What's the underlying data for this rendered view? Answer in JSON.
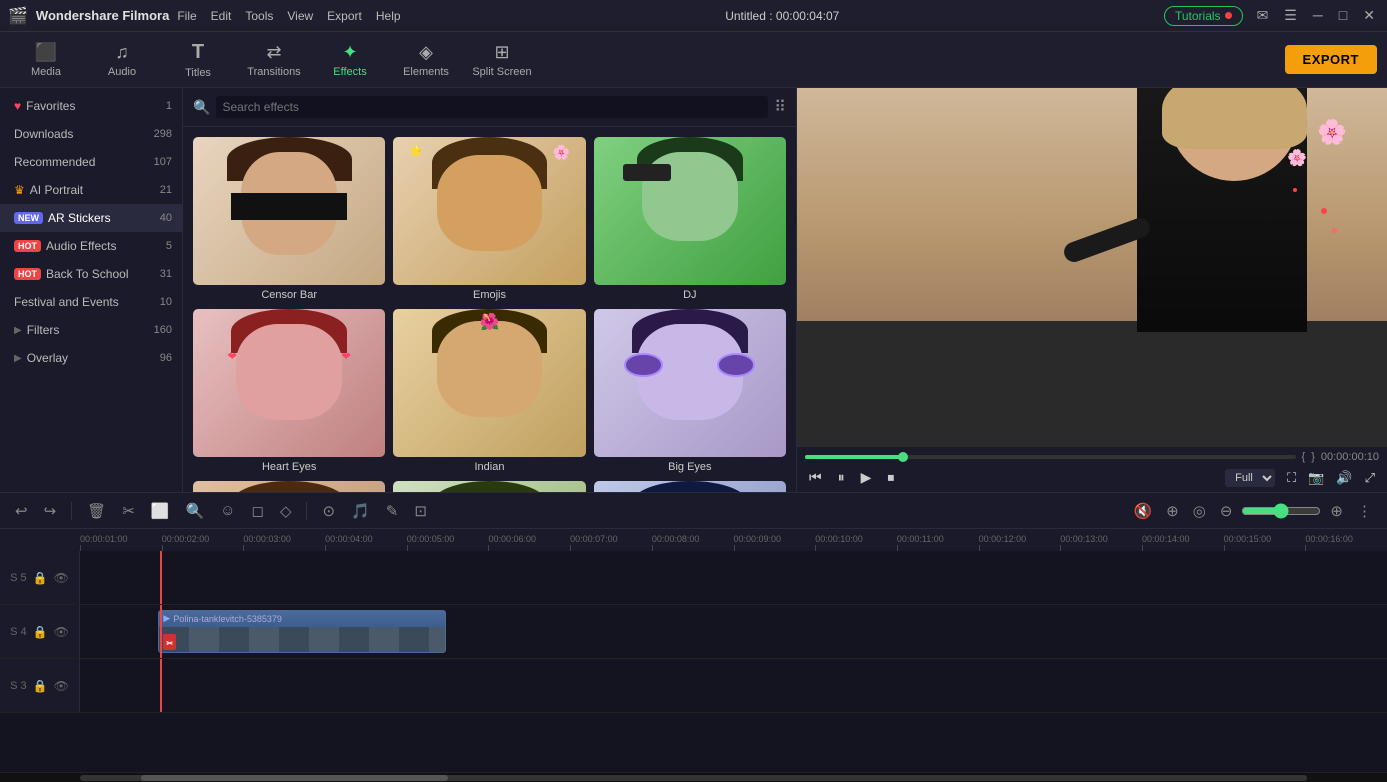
{
  "app": {
    "name": "Wondershare Filmora",
    "title": "Untitled : 00:00:04:07",
    "logo": "🎬"
  },
  "menu": {
    "items": [
      "File",
      "Edit",
      "Tools",
      "View",
      "Export",
      "Help"
    ]
  },
  "header": {
    "tutorials_label": "Tutorials",
    "export_label": "EXPORT"
  },
  "toolbar": {
    "items": [
      {
        "id": "media",
        "label": "Media",
        "icon": "⬜"
      },
      {
        "id": "audio",
        "label": "Audio",
        "icon": "♪"
      },
      {
        "id": "titles",
        "label": "Titles",
        "icon": "T"
      },
      {
        "id": "transitions",
        "label": "Transitions",
        "icon": "⇄"
      },
      {
        "id": "effects",
        "label": "Effects",
        "icon": "✦",
        "active": true
      },
      {
        "id": "elements",
        "label": "Elements",
        "icon": "◈"
      },
      {
        "id": "splitscreen",
        "label": "Split Screen",
        "icon": "⊞"
      }
    ]
  },
  "sidebar": {
    "items": [
      {
        "id": "favorites",
        "label": "Favorites",
        "count": 1,
        "icon": "heart"
      },
      {
        "id": "downloads",
        "label": "Downloads",
        "count": 298,
        "icon": ""
      },
      {
        "id": "recommended",
        "label": "Recommended",
        "count": 107,
        "icon": ""
      },
      {
        "id": "ai-portrait",
        "label": "AI Portrait",
        "count": 21,
        "icon": "crown"
      },
      {
        "id": "ar-stickers",
        "label": "AR Stickers",
        "count": 40,
        "icon": "new",
        "active": true
      },
      {
        "id": "audio-effects",
        "label": "Audio Effects",
        "count": 5,
        "icon": "hot"
      },
      {
        "id": "back-to-school",
        "label": "Back To School",
        "count": 31,
        "icon": "hot"
      },
      {
        "id": "festival-events",
        "label": "Festival and Events",
        "count": 10,
        "icon": ""
      },
      {
        "id": "filters",
        "label": "Filters",
        "count": 160,
        "icon": "arrow"
      },
      {
        "id": "overlay",
        "label": "Overlay",
        "count": 96,
        "icon": "arrow"
      }
    ]
  },
  "effects": {
    "search_placeholder": "Search effects",
    "items": [
      {
        "id": "censor-bar",
        "label": "Censor Bar",
        "type": "censor"
      },
      {
        "id": "emojis",
        "label": "Emojis",
        "type": "emoji"
      },
      {
        "id": "dj",
        "label": "DJ",
        "type": "dj"
      },
      {
        "id": "heart-eyes",
        "label": "Heart Eyes",
        "type": "heart"
      },
      {
        "id": "indian",
        "label": "Indian",
        "type": "indian"
      },
      {
        "id": "big-eyes",
        "label": "Big Eyes",
        "type": "bigeyes"
      },
      {
        "id": "effect7",
        "label": "",
        "type": "censor"
      },
      {
        "id": "effect8",
        "label": "",
        "type": "emoji"
      },
      {
        "id": "effect9",
        "label": "",
        "type": "heart"
      }
    ]
  },
  "preview": {
    "timecode": "00:00:00:10",
    "quality": "Full",
    "playhead_pct": 20
  },
  "timeline": {
    "ruler_marks": [
      "00:00:01:00",
      "00:00:02:00",
      "00:00:03:00",
      "00:00:04:00",
      "00:00:05:00",
      "00:00:06:00",
      "00:00:07:00",
      "00:00:08:00",
      "00:00:09:00",
      "00:00:10:00",
      "00:00:11:00",
      "00:00:12:00",
      "00:00:13:00",
      "00:00:14:00",
      "00:00:15:00",
      "00:00:16:00"
    ],
    "tracks": [
      {
        "id": "track5",
        "num": "5",
        "clip": null
      },
      {
        "id": "track4",
        "num": "4",
        "clip": {
          "label": "Polina-tanklevitch-5385379",
          "left_pct": 6,
          "width_pct": 22
        }
      },
      {
        "id": "track3",
        "num": "3",
        "clip": null
      }
    ]
  },
  "edit_toolbar": {
    "buttons": [
      "↩",
      "↪",
      "🗑",
      "✂",
      "⬜",
      "🔍",
      "☺",
      "□",
      "◇",
      "⟳",
      "≡",
      "🎵",
      "✎",
      "⊡",
      "🔕",
      "⊕",
      "⊖"
    ]
  }
}
